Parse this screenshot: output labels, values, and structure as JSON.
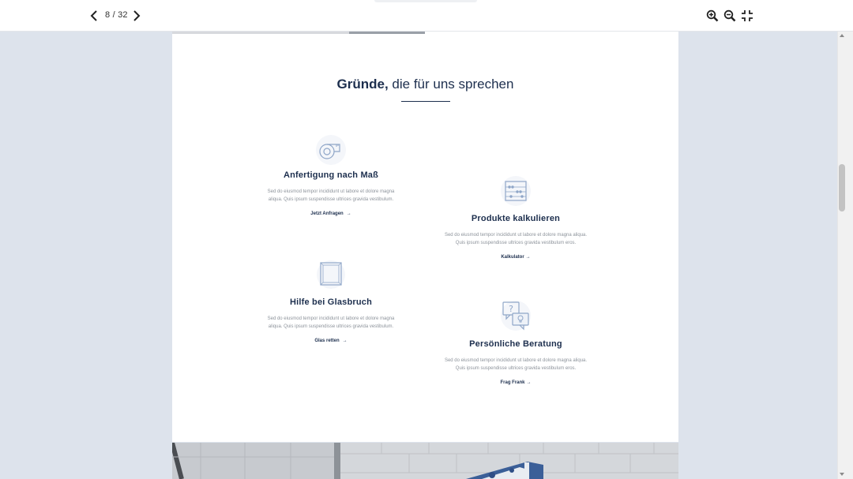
{
  "toolbar": {
    "page_indicator": "8 / 32",
    "prev_icon": "chevron-left-icon",
    "next_icon": "chevron-right-icon",
    "zoom_in_icon": "zoom-in-icon",
    "zoom_out_icon": "zoom-out-icon",
    "collapse_icon": "exit-fullscreen-icon"
  },
  "section": {
    "title_strong": "Gründe,",
    "title_rest": " die für uns sprechen"
  },
  "features": [
    {
      "icon": "measuring-tape-icon",
      "title": "Anfertigung nach Maß",
      "desc_line1": "Sed do eiusmod tempor incididunt ut labore et dolore magna",
      "desc_line2": "aliqua. Quis ipsum suspendisse ultrices gravida vestibulum.",
      "link": "Jetzt Anfragen"
    },
    {
      "icon": "abacus-icon",
      "title": "Produkte kalkulieren",
      "desc_line1": "Sed do eiusmod tempor incididunt ut labore et dolore magna aliqua.",
      "desc_line2": "Quis ipsum suspendisse ultrices gravida vestibulum eros.",
      "link": "Kalkulator"
    },
    {
      "icon": "glass-pane-icon",
      "title": "Hilfe bei Glasbruch",
      "desc_line1": "Sed do eiusmod tempor incididunt ut labore et dolore magna",
      "desc_line2": "aliqua. Quis ipsum suspendisse ultrices gravida vestibulum.",
      "link": "Glas retten"
    },
    {
      "icon": "chat-bubbles-icon",
      "title": "Persönliche Beratung",
      "desc_line1": "Sed do eiusmod tempor incididunt ut labore et dolore magna aliqua.",
      "desc_line2": "Quis ipsum suspendisse ultrices gravida vestibulum eros.",
      "link": "Frag Frank"
    }
  ],
  "link_arrow": "→",
  "colors": {
    "accent_navy": "#1d2f4e",
    "icon_blue": "#8fa6c8",
    "viewer_bg": "#dde3ec"
  }
}
